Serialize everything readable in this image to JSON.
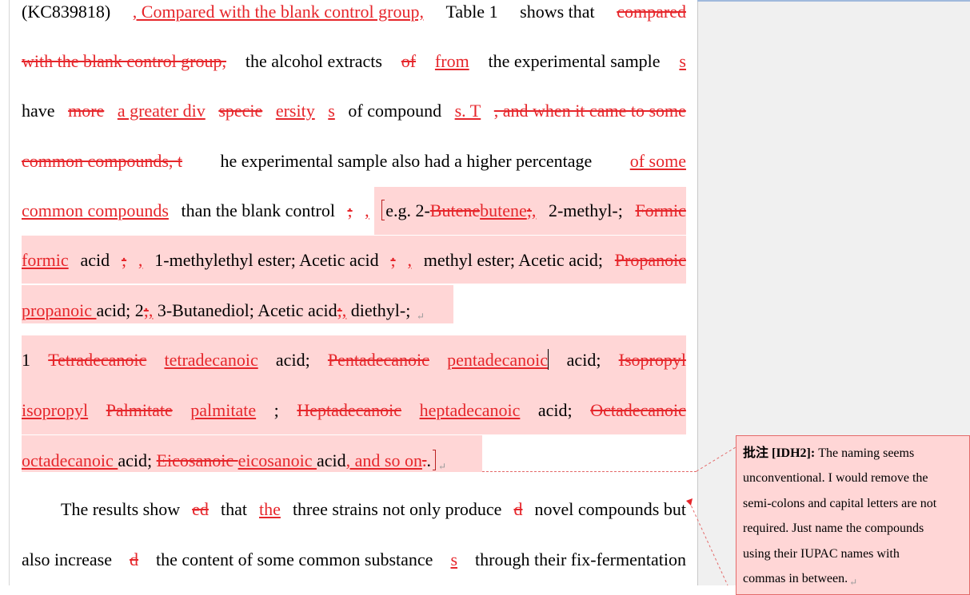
{
  "document": {
    "line1": {
      "a": "(KC839818)",
      "b": ", Compared with the blank control group, ",
      "c": "Table 1",
      "d": " shows that",
      "e": " compared"
    },
    "line2": {
      "a": "with the blank control group,",
      "b": " the alcohol extracts ",
      "c": "of ",
      "d": "from ",
      "e": "the experimental sample",
      "f": "s"
    },
    "line3": {
      "a": "have ",
      "b": "more ",
      "c": "a greater div",
      "d": "specie",
      "e": "ersity",
      "f": "s",
      "g": " of compound",
      "h": "s. T",
      "i": ", and when it came to some"
    },
    "line4": {
      "a": "common compounds, t",
      "b": "he experimental sample also had a higher percentage ",
      "c": "of some"
    },
    "line5": {
      "a": "common compounds ",
      "b": "than the blank control",
      "c": ";",
      "d": ",",
      "e": "e.g. 2-",
      "f": "Butene",
      "g": "butene",
      "h": ";",
      "i": ",",
      "j": " 2-methyl-; ",
      "k": "Formic"
    },
    "line6": {
      "a": "formic ",
      "b": "acid",
      "c": ";",
      "d": ",",
      "e": " 1-methylethyl ester; Acetic acid",
      "f": ";",
      "g": ",",
      "h": " methyl ester; Acetic acid; ",
      "i": "Propanoic"
    },
    "line7": {
      "a": "propanoic ",
      "b": "acid; 2",
      "c": ";",
      "d": ",",
      "e": " 3-Butanediol; Acetic acid",
      "f": ";",
      "g": ",",
      "h": " diethyl-; ",
      "pm": "↵"
    },
    "line8": {
      "a": "1 ",
      "b": "Tetradecanoic ",
      "c": "tetradecanoic ",
      "d": "acid; ",
      "e": "Pentadecanoic ",
      "f": "pentadecanoic",
      "g": " acid; ",
      "h": "Isopropyl"
    },
    "line9": {
      "a": "isopropyl ",
      "b": "Palmitate",
      "c": "palmitate",
      "d": "; ",
      "e": "Heptadecanoic ",
      "f": "heptadecanoic ",
      "g": "acid; ",
      "h": "Octadecanoic"
    },
    "line10": {
      "a": "octadecanoic ",
      "b": "acid; ",
      "c": "Eicosanoic ",
      "d": "eicosanoic ",
      "e": "acid",
      "f": ", and so on",
      "g": ".",
      "h": ".",
      "pm": "↵"
    },
    "line11": {
      "a": "The results show",
      "b": "ed",
      "c": " that ",
      "d": "the ",
      "e": "three strains not only produce",
      "f": "d",
      "g": " novel compounds but"
    },
    "line12": {
      "a": "also increase",
      "b": "d",
      "c": " the content of some common substance",
      "d": "s",
      "e": " through their fix-fermentation"
    }
  },
  "comment": {
    "label": "批注 [IDH2]:",
    "lines": [
      " The naming seems",
      "unconventional. I would remove the",
      "semi-colons and capital letters are not",
      "required. Just name the compounds",
      "using their IUPAC names with",
      "commas in between."
    ],
    "pm": "↵"
  },
  "colors": {
    "revision": "#e6262b",
    "comment_highlight": "#ffd6d6",
    "comment_border": "#e46a6a",
    "margin_background": "#f0f0f0"
  }
}
